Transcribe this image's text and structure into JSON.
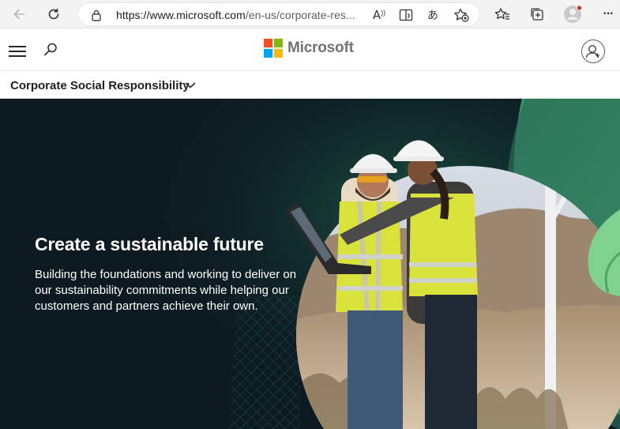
{
  "browser": {
    "url_host": "https://www.microsoft.com",
    "url_path": "/en-us/corporate-res...",
    "icons": [
      "back-icon",
      "refresh-icon",
      "lock-icon",
      "read-aloud-icon",
      "immersive-reader-icon",
      "translate-icon",
      "add-favorite-icon",
      "favorites-icon",
      "collections-icon",
      "profile-icon",
      "more-icon"
    ],
    "read_aloud_glyph": "A",
    "translate_glyph": "あ",
    "more_glyph": "···"
  },
  "header": {
    "brand_name": "Microsoft",
    "logo_colors": [
      "#f25022",
      "#7fba00",
      "#00a4ef",
      "#ffb900"
    ]
  },
  "subnav": {
    "title": "Corporate Social Responsibility"
  },
  "hero": {
    "title": "Create a sustainable future",
    "body": "Building the foundations and working to deliver on our sustainability commitments while helping our customers and partners achieve their own.",
    "colors": {
      "background": "#0d1a22",
      "accent_green": "#54c07a",
      "vest_yellow": "#d9e23a"
    }
  }
}
